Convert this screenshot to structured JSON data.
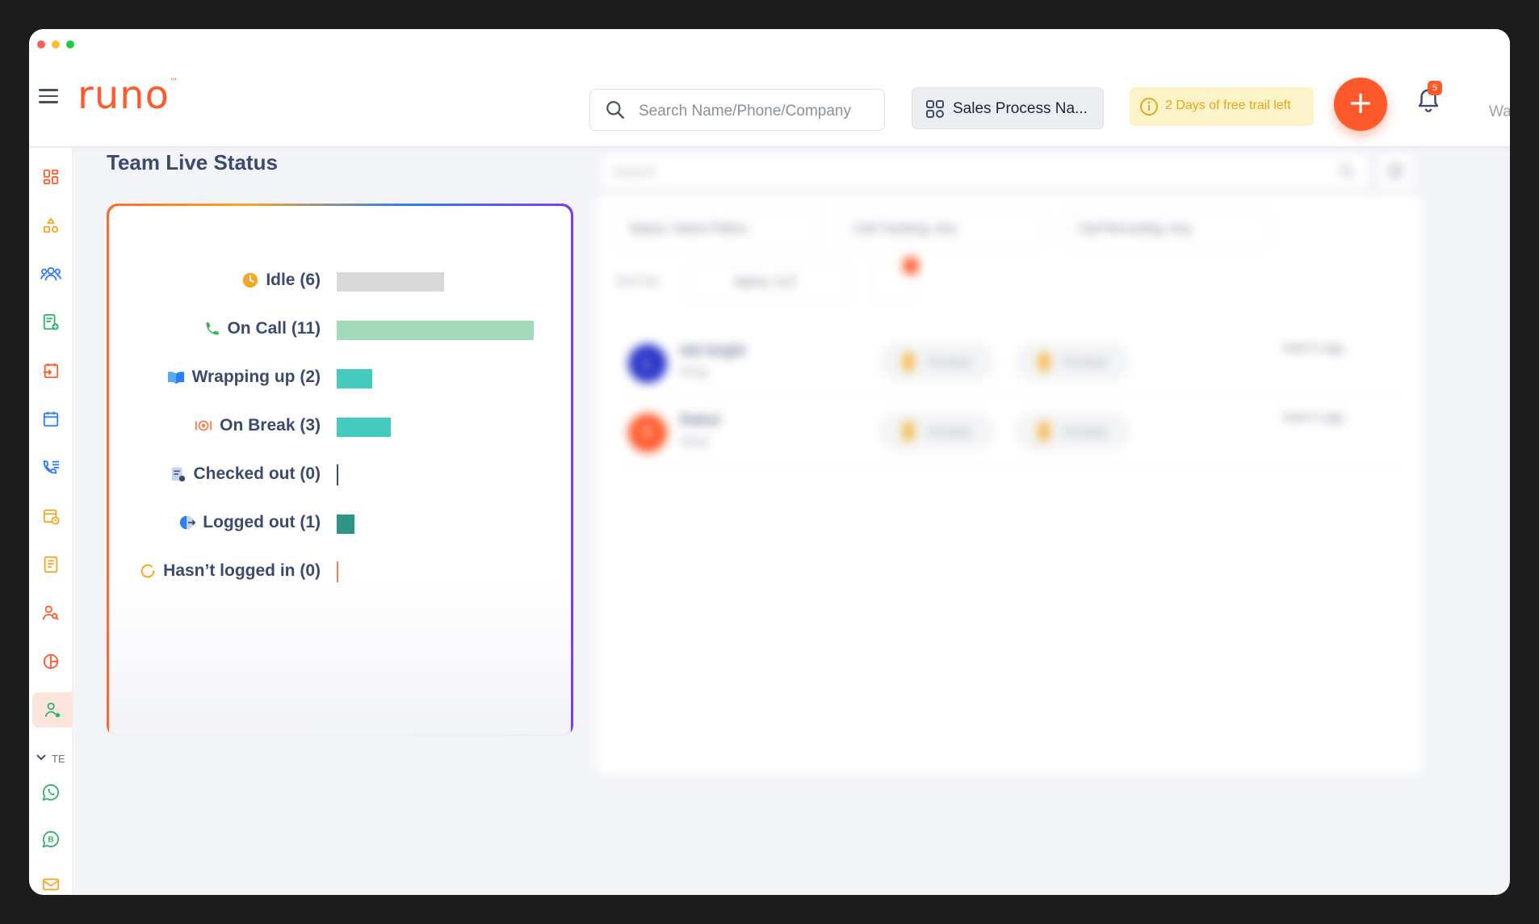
{
  "window": {
    "traffic_lights": [
      "#ff5f57",
      "#febc2e",
      "#28c840"
    ]
  },
  "header": {
    "logo_text": "runo",
    "logo_tm": "™",
    "search_placeholder": "Search Name/Phone/Company",
    "process_label": "Sales Process Na...",
    "trial_text": "2 Days of free trail left",
    "add_label": "+",
    "notification_count": "5",
    "user_partial": "Wa"
  },
  "sidebar": {
    "items": [
      {
        "icon": "dashboard-icon",
        "color": "#ff5a2c"
      },
      {
        "icon": "shapes-icon",
        "color": "#f5a623"
      },
      {
        "icon": "team-icon",
        "color": "#2d7df5"
      },
      {
        "icon": "form-add-icon",
        "color": "#2fb36d"
      },
      {
        "icon": "transfer-icon",
        "color": "#ff5a2c"
      },
      {
        "icon": "calendar-icon",
        "color": "#2d7df5"
      },
      {
        "icon": "call-log-icon",
        "color": "#2d7df5"
      },
      {
        "icon": "schedule-icon",
        "color": "#f5a623"
      },
      {
        "icon": "report-icon",
        "color": "#f5a623"
      },
      {
        "icon": "user-search-icon",
        "color": "#ff5a2c"
      },
      {
        "icon": "pie-chart-icon",
        "color": "#ff5a2c"
      },
      {
        "icon": "live-status-icon",
        "color": "#2fb36d",
        "active": true
      },
      {
        "icon": "whatsapp-icon",
        "color": "#2fb36d"
      },
      {
        "icon": "whatsapp-business-icon",
        "color": "#2fb36d"
      },
      {
        "icon": "mail-icon",
        "color": "#f5a623"
      }
    ],
    "section_label": "TE"
  },
  "page": {
    "title": "Team Live Status"
  },
  "live_status": {
    "rows": [
      {
        "label": "Idle (6)",
        "count": 6,
        "color": "#d9d9d9",
        "icon": "clock-icon"
      },
      {
        "label": "On Call (11)",
        "count": 11,
        "color": "#a3dbb8",
        "icon": "phone-icon"
      },
      {
        "label": "Wrapping up (2)",
        "count": 2,
        "color": "#45cbbd",
        "icon": "book-icon"
      },
      {
        "label": "On Break (3)",
        "count": 3,
        "color": "#45cbbd",
        "icon": "meal-icon"
      },
      {
        "label": "Checked out (0)",
        "count": 0,
        "color": "#3c4a6c",
        "icon": "checkout-icon"
      },
      {
        "label": "Logged out (1)",
        "count": 1,
        "color": "#2e9488",
        "icon": "logout-icon"
      },
      {
        "label": "Hasn’t logged in (0)",
        "count": 0,
        "color": "#ff7a45",
        "icon": "refresh-icon"
      }
    ]
  },
  "agents_panel": {
    "search_placeholder": "Search",
    "filters": [
      "Status: Select Filters",
      "Call Tracking: Any",
      "Call Recording: Any"
    ],
    "sort_label": "Sort by",
    "sort_value": "Name: A-Z",
    "agents": [
      {
        "initial": "L",
        "name": "loki bright",
        "sub": "desg",
        "avatar_color": "#2b36c9",
        "pill1": "Pending*",
        "pill2": "Pending*",
        "status": "Hasn't Logg..."
      },
      {
        "initial": "R",
        "name": "Rahul",
        "sub": "desg",
        "avatar_color": "#ff5a2c",
        "pill1": "Pending*",
        "pill2": "Pending*",
        "status": "Hasn't Logg..."
      }
    ]
  }
}
